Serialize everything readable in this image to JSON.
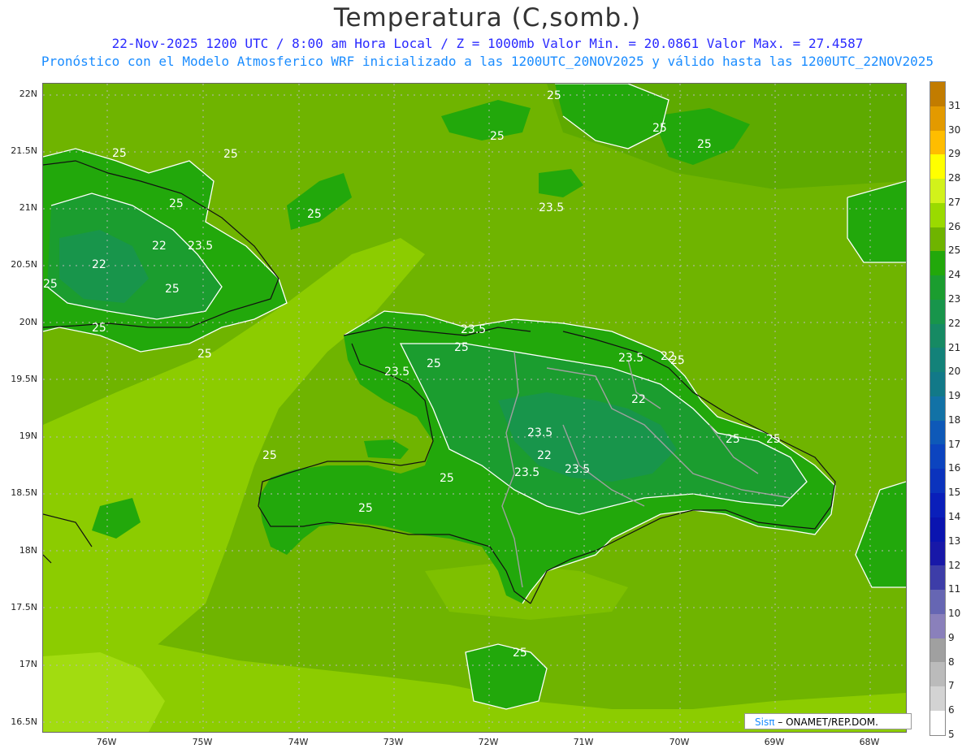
{
  "title": "Temperatura (C,somb.)",
  "subtitle_1": "22-Nov-2025  1200 UTC / 8:00 am Hora Local / Z = 1000mb   Valor Min. = 20.0861  Valor Max. = 27.4587",
  "subtitle_2": "Pronóstico con el Modelo Atmosferico WRF inicializado a las 1200UTC_20NOV2025 y válido hasta las  1200UTC_22NOV2025",
  "lat_labels": [
    "22N",
    "21.5N",
    "21N",
    "20.5N",
    "20N",
    "19.5N",
    "19N",
    "18.5N",
    "18N",
    "17.5N",
    "17N",
    "16.5N"
  ],
  "lon_labels": [
    "76W",
    "75W",
    "74W",
    "73W",
    "72W",
    "71W",
    "70W",
    "69W",
    "68W"
  ],
  "contour_labels": [
    "25",
    "25",
    "25",
    "25",
    "25",
    "25",
    "25",
    "23.5",
    "25",
    "22",
    "23.5",
    "22",
    "25",
    "25",
    "25",
    "25",
    "23.5",
    "25",
    "25",
    "23.5",
    "22",
    "22",
    "23.5",
    "25",
    "23.5",
    "22",
    "23.5",
    "23.5",
    "25",
    "25",
    "25",
    "25",
    "25",
    "25"
  ],
  "colorbar": {
    "labels": [
      "31",
      "30",
      "29",
      "28",
      "27",
      "26",
      "25",
      "24",
      "23",
      "22",
      "21",
      "20",
      "19",
      "18",
      "17",
      "16",
      "15",
      "14",
      "13",
      "12",
      "11",
      "10",
      "9",
      "8",
      "7",
      "6",
      "5"
    ],
    "colors": [
      "#c27c00",
      "#e39a00",
      "#ffbd00",
      "#ffff00",
      "#d2f21b",
      "#9ada00",
      "#6fb400",
      "#22a80b",
      "#1b9d2f",
      "#18954b",
      "#168a63",
      "#138279",
      "#127988",
      "#1272a6",
      "#0e59b8",
      "#0c44bf",
      "#0b33bd",
      "#0a1fba",
      "#0a14b0",
      "#1818a8",
      "#3d3da8",
      "#6666b3",
      "#8a80bb",
      "#a0a0a0",
      "#bbbbbb",
      "#d3d3d3",
      "#ffffff"
    ]
  },
  "credit": {
    "sis": "Sisπ",
    "org": "– ONAMET/REP.DOM."
  }
}
